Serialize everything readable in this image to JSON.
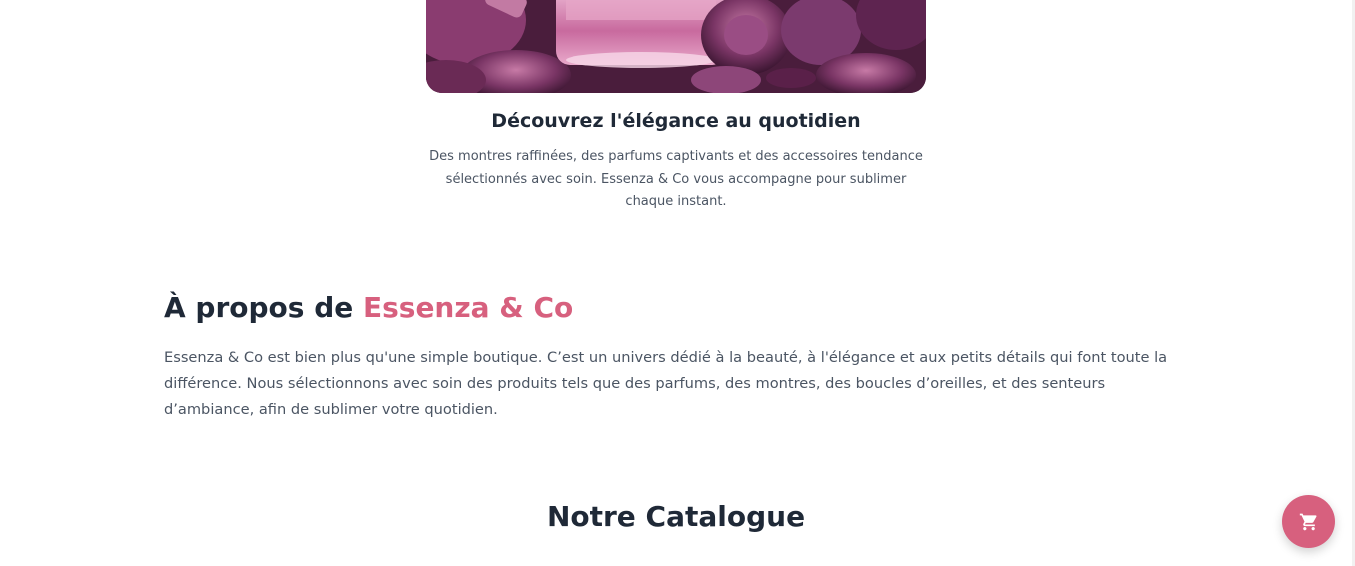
{
  "hero": {
    "image_icon": "perfume-roses-image",
    "title": "Découvrez l'élégance au quotidien",
    "description": "Des montres raffinées, des parfums captivants et des accessoires tendance sélectionnés avec soin. Essenza & Co vous accompagne pour sublimer chaque instant."
  },
  "about": {
    "heading_prefix": "À propos de ",
    "heading_brand": "Essenza & Co",
    "text": "Essenza & Co est bien plus qu'une simple boutique. C’est un univers dédié à la beauté, à l'élégance et aux petits détails qui font toute la différence. Nous sélectionnons avec soin des produits tels que des parfums, des montres, des boucles d’oreilles, et des senteurs d’ambiance, afin de sublimer votre quotidien."
  },
  "catalog": {
    "heading": "Notre Catalogue"
  },
  "cart": {
    "icon": "cart-icon"
  },
  "colors": {
    "accent": "#d7607e",
    "heading": "#1f2937",
    "body_text": "#4b5563"
  }
}
